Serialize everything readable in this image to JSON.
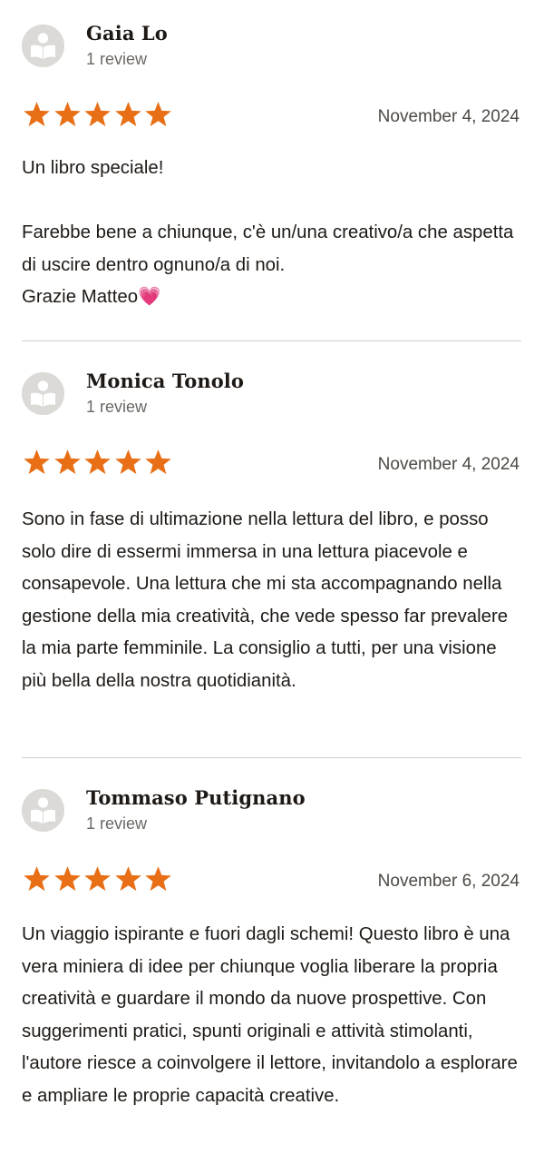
{
  "accent_color": "#e86f16",
  "star_icon": "star-filled-icon",
  "avatar_icon": "reader-avatar-icon",
  "reviews": [
    {
      "name": "Gaia Lo",
      "review_count": "1 review",
      "rating": 5,
      "rating_max": 5,
      "date": "November 4, 2024",
      "body": [
        "Un libro speciale!",
        "",
        "Farebbe bene a chiunque, c'è un/una creativo/a che aspetta di uscire dentro ognuno/a di noi.",
        "Grazie Matteo💗"
      ]
    },
    {
      "name": "Monica Tonolo",
      "review_count": "1 review",
      "rating": 5,
      "rating_max": 5,
      "date": "November 4, 2024",
      "body": [
        "Sono in fase di ultimazione nella lettura del libro, e posso solo dire di essermi immersa in una lettura piacevole e consapevole. Una lettura che mi sta accompagnando nella gestione della mia creatività, che vede spesso far prevalere la mia parte femminile. La consiglio a tutti, per una visione più bella della nostra quotidianità."
      ]
    },
    {
      "name": "Tommaso Putignano",
      "review_count": "1 review",
      "rating": 5,
      "rating_max": 5,
      "date": "November 6, 2024",
      "body": [
        "Un viaggio ispirante e fuori dagli schemi! Questo libro è una vera miniera di idee per chiunque voglia liberare la propria creatività e guardare il mondo da nuove prospettive. Con suggerimenti pratici, spunti originali e attività stimolanti, l'autore riesce a coinvolgere il lettore, invitandolo a esplorare e ampliare le proprie capacità creative."
      ]
    }
  ]
}
